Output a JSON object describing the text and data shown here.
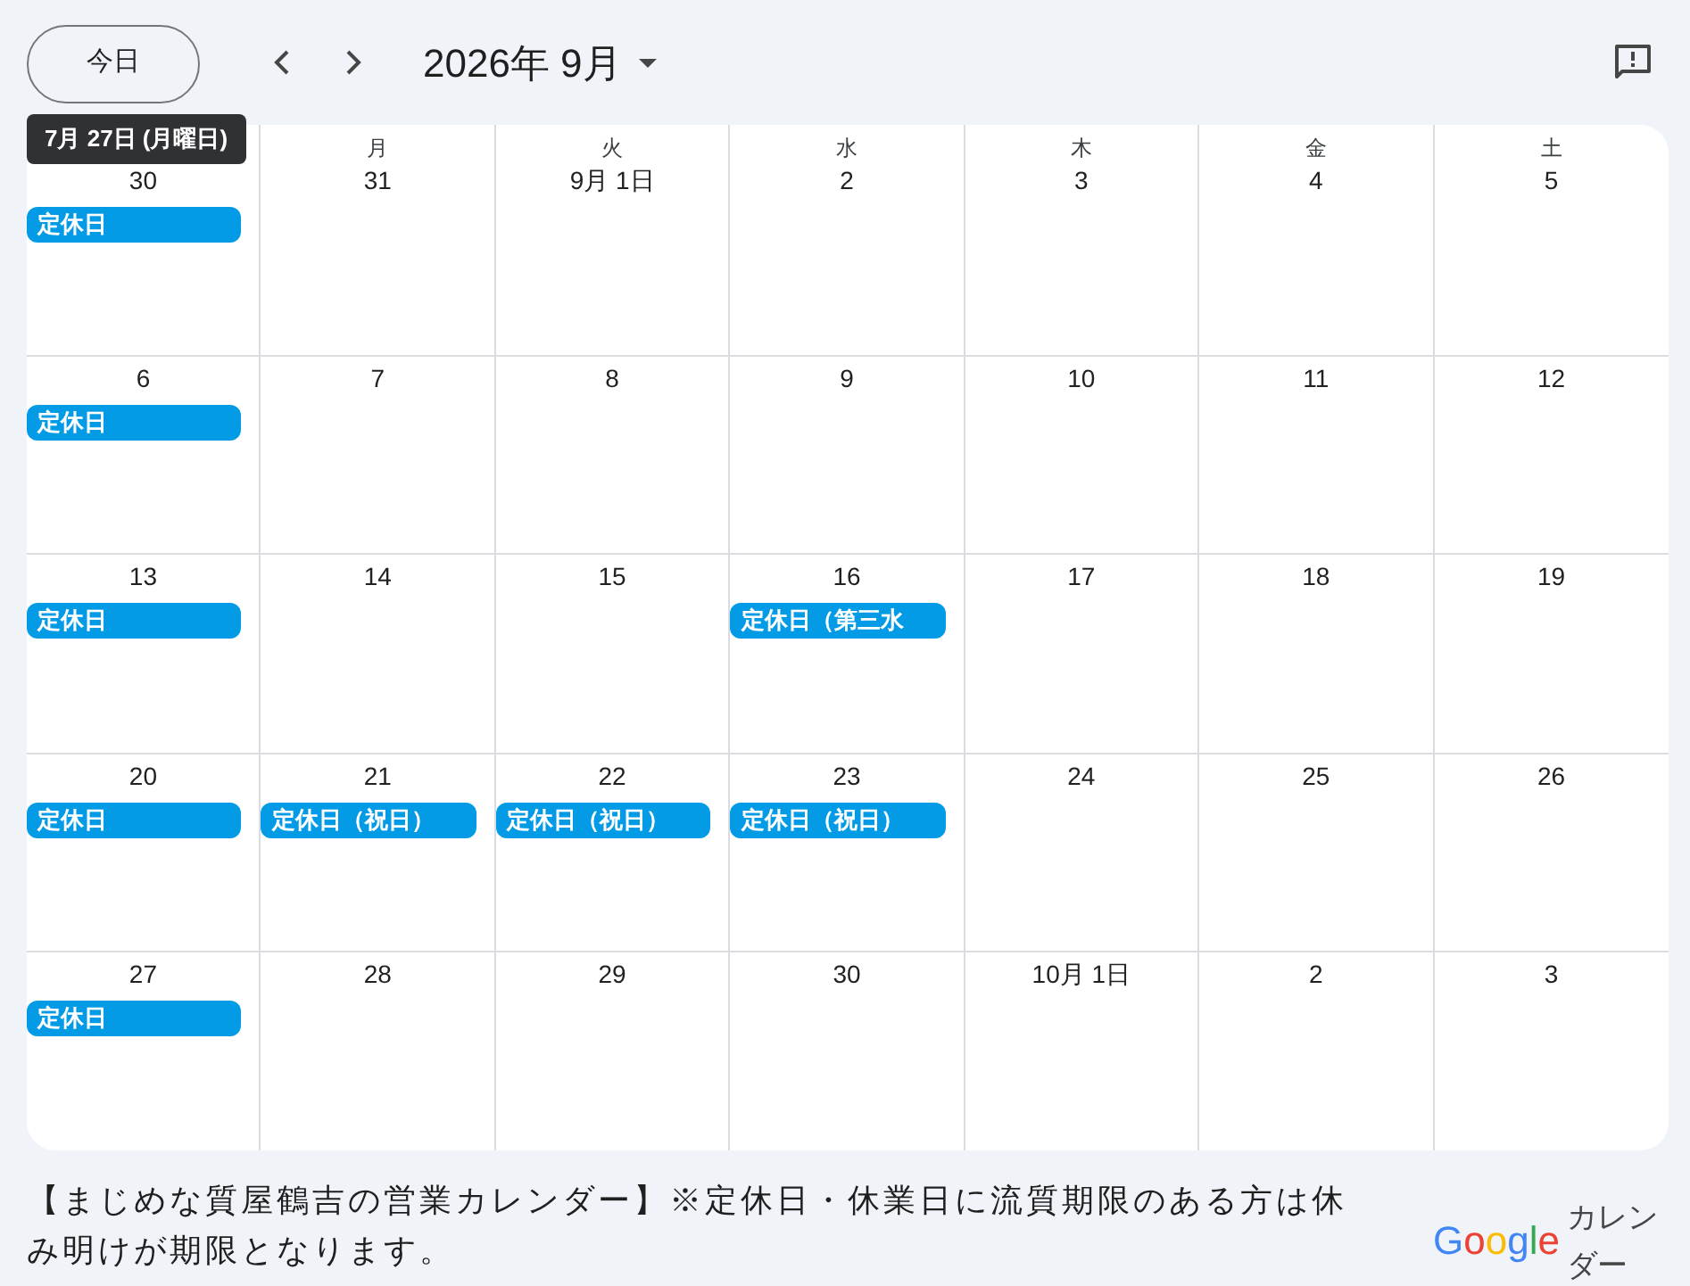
{
  "toolbar": {
    "today_button": "今日",
    "month_title": "2026年 9月"
  },
  "tooltip": "7月 27日 (月曜日)",
  "weekdays": [
    "月",
    "火",
    "水",
    "木",
    "金",
    "土"
  ],
  "weeks": [
    [
      {
        "date": "30",
        "events": [
          "定休日"
        ]
      },
      {
        "date": "31"
      },
      {
        "date": "9月 1日"
      },
      {
        "date": "2"
      },
      {
        "date": "3"
      },
      {
        "date": "4"
      },
      {
        "date": "5"
      }
    ],
    [
      {
        "date": "6",
        "events": [
          "定休日"
        ]
      },
      {
        "date": "7"
      },
      {
        "date": "8"
      },
      {
        "date": "9"
      },
      {
        "date": "10"
      },
      {
        "date": "11"
      },
      {
        "date": "12"
      }
    ],
    [
      {
        "date": "13",
        "events": [
          "定休日"
        ]
      },
      {
        "date": "14"
      },
      {
        "date": "15"
      },
      {
        "date": "16",
        "events": [
          "定休日（第三水"
        ]
      },
      {
        "date": "17"
      },
      {
        "date": "18"
      },
      {
        "date": "19"
      }
    ],
    [
      {
        "date": "20",
        "events": [
          "定休日"
        ]
      },
      {
        "date": "21",
        "events": [
          "定休日（祝日）"
        ]
      },
      {
        "date": "22",
        "events": [
          "定休日（祝日）"
        ]
      },
      {
        "date": "23",
        "events": [
          "定休日（祝日）"
        ]
      },
      {
        "date": "24"
      },
      {
        "date": "25"
      },
      {
        "date": "26"
      }
    ],
    [
      {
        "date": "27",
        "events": [
          "定休日"
        ]
      },
      {
        "date": "28"
      },
      {
        "date": "29"
      },
      {
        "date": "30"
      },
      {
        "date": "10月 1日"
      },
      {
        "date": "2"
      },
      {
        "date": "3"
      }
    ]
  ],
  "footer": {
    "description": "【まじめな質屋鶴吉の営業カレンダー】※定休日・休業日に流質期限のある方は休み明けが期限となります。",
    "logo": "Google",
    "product": "カレンダー"
  }
}
